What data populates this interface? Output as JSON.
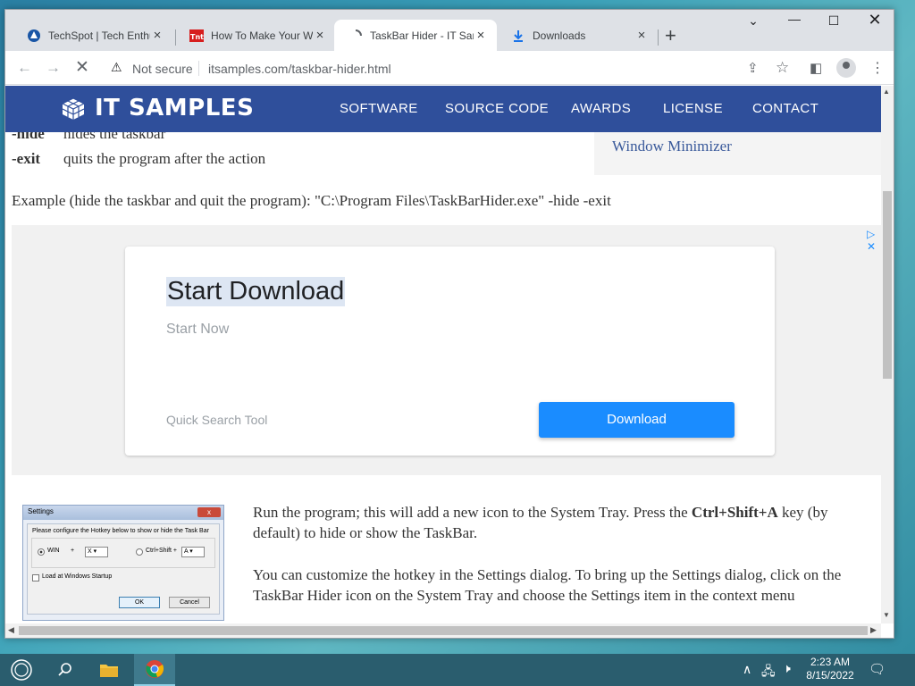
{
  "browser": {
    "tabs": [
      {
        "title": "TechSpot | Tech Enthu",
        "favicon": "techspot-icon",
        "active": false
      },
      {
        "title": "How To Make Your W",
        "favicon": "tnt-icon",
        "active": false
      },
      {
        "title": "TaskBar Hider - IT San",
        "favicon": "loading-icon",
        "active": true
      },
      {
        "title": "Downloads",
        "favicon": "download-icon",
        "active": false
      }
    ],
    "new_tab_label": "+",
    "security_label": "Not secure",
    "url": "itsamples.com/taskbar-hider.html"
  },
  "site": {
    "logo_text": "IT SAMPLES",
    "nav": [
      "SOFTWARE",
      "SOURCE CODE",
      "AWARDS",
      "LICENSE",
      "CONTACT"
    ],
    "header_bg": "#2f4f9b"
  },
  "content": {
    "options": [
      {
        "key": "-hide",
        "desc": "hides the taskbar"
      },
      {
        "key": "-exit",
        "desc": "quits the program after the action"
      }
    ],
    "sidebar_link": "Window Minimizer",
    "example": "Example (hide the taskbar and quit the program): \"C:\\Program Files\\TaskBarHider.exe\" -hide -exit",
    "para1_pre": "Run the program; this will add a new icon to the System Tray. Press the ",
    "para1_bold": "Ctrl+Shift+A",
    "para1_post": " key (by default) to hide or show the TaskBar.",
    "para2": "You can customize the hotkey in the Settings dialog. To bring up the Settings dialog, click on the TaskBar Hider icon on the System Tray and choose the Settings item in the context menu"
  },
  "ad": {
    "title": "Start Download",
    "subtitle": "Start Now",
    "footer": "Quick Search Tool",
    "button": "Download",
    "accent": "#1a8cff"
  },
  "settings_dialog": {
    "title": "Settings",
    "instruction": "Please configure the Hotkey below to show or hide the Task Bar",
    "win_label": "WIN",
    "plus": "+",
    "key1": "X",
    "ctrlshift_label": "Ctrl+Shift +",
    "key2": "A",
    "startup_label": "Load at Windows Startup",
    "ok": "OK",
    "cancel": "Cancel"
  },
  "taskbar": {
    "time": "2:23 AM",
    "date": "8/15/2022"
  }
}
